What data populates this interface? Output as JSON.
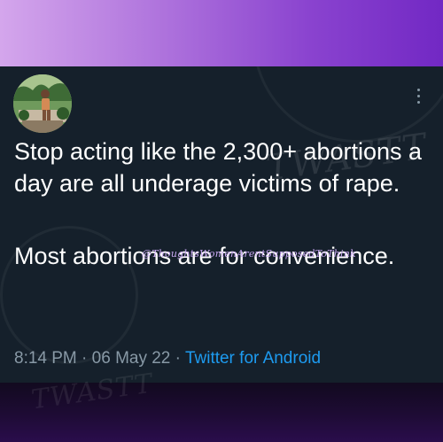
{
  "tweet": {
    "paragraph1": "Stop acting like the 2,300+ abortions a day are all underage victims of rape.",
    "paragraph2": "Most abortions are for convenience.",
    "time": "8:14 PM",
    "separator": "·",
    "date": "06 May 22",
    "source": "Twitter for Android"
  },
  "overlay": {
    "handle": "@ThoughtsWomenArentSupposedToThink",
    "watermark": "TWASTT"
  },
  "icons": {
    "more": "more-vertical-icon",
    "avatar": "profile-photo"
  },
  "colors": {
    "tweet_background": "#15202b",
    "text": "#ffffff",
    "meta_text": "#8899a6",
    "link": "#1d9bf0",
    "top_gradient_start": "#d4a6ec",
    "top_gradient_end": "#7228c4",
    "bottom_band": "#1e0b35"
  }
}
